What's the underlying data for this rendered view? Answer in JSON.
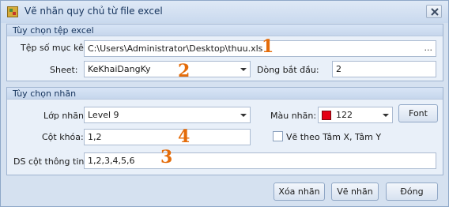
{
  "window": {
    "title": "Vẽ nhãn quy chủ từ file excel"
  },
  "excel_group": {
    "title": "Tùy chọn tệp excel",
    "file_label": "Tệp số mục kê:",
    "file_value": "C:\\Users\\Administrator\\Desktop\\thuu.xls",
    "browse_label": "...",
    "sheet_label": "Sheet:",
    "sheet_value": "KeKhaiDangKy",
    "start_row_label": "Dòng bắt đầu:",
    "start_row_value": "2"
  },
  "label_group": {
    "title": "Tùy chọn nhãn",
    "layer_label": "Lớp nhãn:",
    "layer_value": "Level 9",
    "color_label": "Màu nhãn:",
    "color_value": "122",
    "color_hex": "#e40013",
    "font_button": "Font",
    "key_col_label": "Cột khóa:",
    "key_col_value": "1,2",
    "center_checkbox_label": "Vẽ theo Tâm X, Tâm Y",
    "info_cols_label": "DS cột thông tin:",
    "info_cols_value": "1,2,3,4,5,6"
  },
  "buttons": {
    "delete": "Xóa nhãn",
    "draw": "Vẽ nhãn",
    "close": "Đóng"
  },
  "annotations": [
    "1",
    "2",
    "3",
    "4"
  ]
}
